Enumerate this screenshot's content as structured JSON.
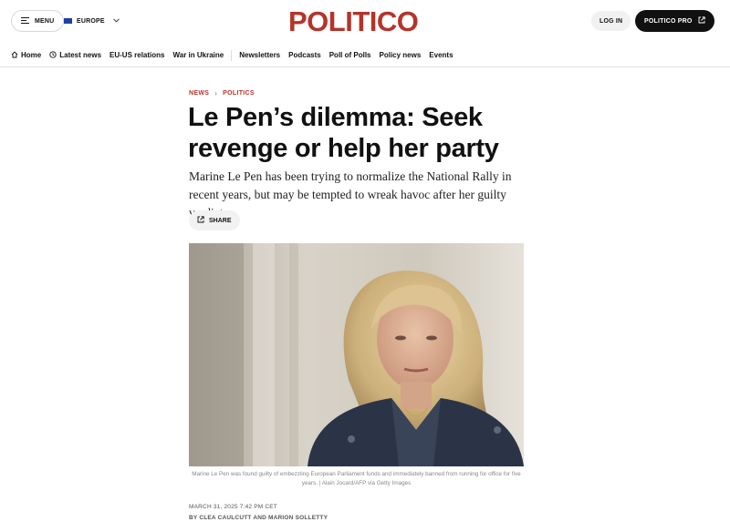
{
  "header": {
    "menu_label": "MENU",
    "edition_label": "EUROPE",
    "logo_text": "POLITICO",
    "login_label": "LOG IN",
    "pro_label": "POLITICO PRO"
  },
  "nav": {
    "items": [
      {
        "label": "Home"
      },
      {
        "label": "Latest news"
      },
      {
        "label": "EU-US relations"
      },
      {
        "label": "War in Ukraine"
      },
      {
        "label": "Newsletters"
      },
      {
        "label": "Podcasts"
      },
      {
        "label": "Poll of Polls"
      },
      {
        "label": "Policy news"
      },
      {
        "label": "Events"
      }
    ]
  },
  "article": {
    "breadcrumb": [
      "NEWS",
      "POLITICS"
    ],
    "headline": "Le Pen’s dilemma: Seek revenge or help her party",
    "dek": "Marine Le Pen has been trying to normalize the National Rally in recent years, but may be tempted to wreak havoc after her guilty verdict.",
    "share_label": "SHARE",
    "caption": "Marine Le Pen was found guilty of embezzling European Parliament funds and immediately banned from running for office for five years. | Alain Jocard/AFP via Getty Images",
    "date": "MARCH 31, 2025 7:42 PM CET",
    "byline": "BY CLEA CAULCUTT AND MARION SOLLETTY"
  },
  "colors": {
    "brand_red": "#b5342a",
    "dark": "#111111"
  }
}
